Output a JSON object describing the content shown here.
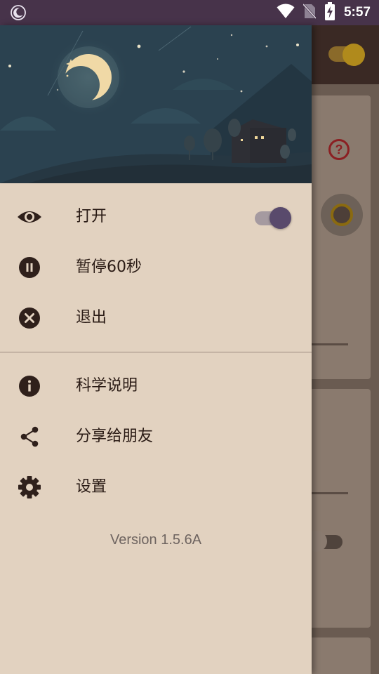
{
  "status_bar": {
    "time": "5:57",
    "icons": [
      "moon-icon",
      "wifi-icon",
      "no-sim-icon",
      "battery-charging-icon"
    ]
  },
  "drawer": {
    "menu": [
      {
        "label": "打开",
        "icon": "eye-icon",
        "toggle_on": true
      },
      {
        "label": "暂停60秒",
        "icon": "pause-circle-icon"
      },
      {
        "label": "退出",
        "icon": "close-circle-icon"
      },
      {
        "label": "科学说明",
        "icon": "info-icon"
      },
      {
        "label": "分享给朋友",
        "icon": "share-icon"
      },
      {
        "label": "设置",
        "icon": "gear-icon"
      }
    ],
    "version": "Version 1.5.6A"
  },
  "background_app": {
    "help_symbol": "?",
    "toggle_on": true
  },
  "colors": {
    "status_bar": "#47334a",
    "drawer_bg": "#e2d2c0",
    "header_sky": "#2b4250",
    "moon": "#f0d9a6",
    "icon_dark": "#2f201b",
    "switch_thumb": "#594a6c"
  }
}
